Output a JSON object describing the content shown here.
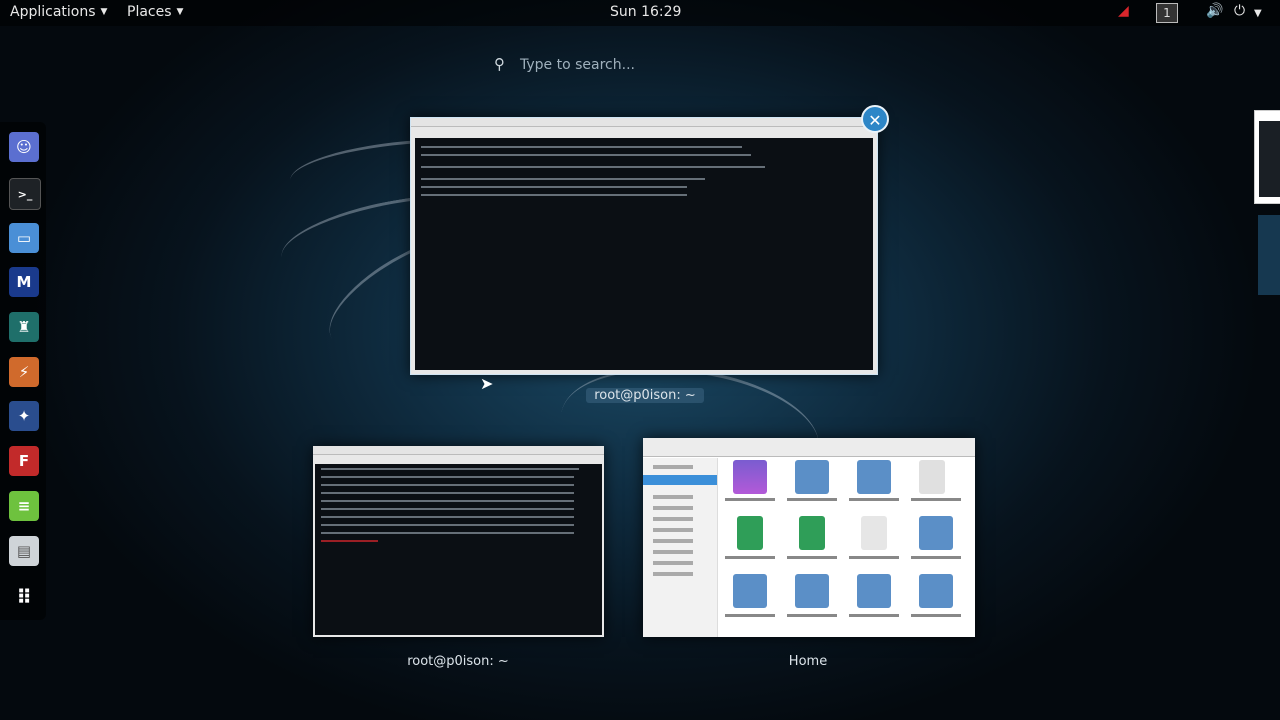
{
  "topbar": {
    "applications": "Applications",
    "places": "Places",
    "clock": "Sun 16:29",
    "workspace": "1"
  },
  "search": {
    "placeholder": "Type to search..."
  },
  "windows": [
    {
      "caption": "root@p0ison: ~",
      "active": true
    },
    {
      "caption": "root@p0ison: ~"
    },
    {
      "caption": "Home"
    }
  ],
  "icons": {
    "close": "close-icon",
    "search": "search-icon",
    "volume": "volume-icon",
    "power": "power-icon",
    "network": "network-icon"
  },
  "colors": {
    "accent": "#2d86c7",
    "selection": "#3b8fd9"
  }
}
